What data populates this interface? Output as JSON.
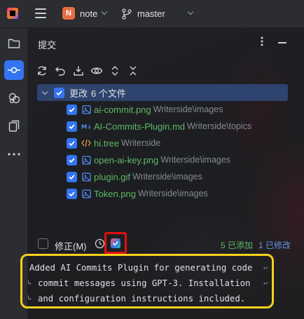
{
  "header": {
    "project_initial": "N",
    "project_name": "note",
    "branch_name": "master"
  },
  "panel": {
    "title": "提交",
    "more_icon": "more-vertical-icon",
    "minimize_icon": "minimize-icon"
  },
  "toolbar": {
    "icons": [
      "refresh-icon",
      "rollback-icon",
      "shelve-icon",
      "show-diff-icon",
      "expand-all-icon",
      "collapse-all-icon"
    ]
  },
  "changes": {
    "group_label": "更改",
    "group_count": "6 个文件",
    "files": [
      {
        "name": "ai-commit.png",
        "path": "Writerside\\images",
        "icon": "image-file-icon"
      },
      {
        "name": "AI-Commits-Plugin.md",
        "path": "Writerside\\topics",
        "icon": "markdown-file-icon"
      },
      {
        "name": "hi.tree",
        "path": "Writerside",
        "icon": "xml-file-icon"
      },
      {
        "name": "open-ai-key.png",
        "path": "Writerside\\images",
        "icon": "image-file-icon"
      },
      {
        "name": "plugin.gif",
        "path": "Writerside\\images",
        "icon": "image-file-icon"
      },
      {
        "name": "Token.png",
        "path": "Writerside\\images",
        "icon": "image-file-icon"
      }
    ]
  },
  "commit": {
    "amend_label": "修正(M)",
    "added_stat": "5 已添加",
    "modified_stat": "1 已修改",
    "message_lines": [
      "Added AI Commits Plugin for generating code",
      "commit messages using GPT-3. Installation",
      "and configuration instructions included."
    ]
  },
  "colors": {
    "accent": "#3574f0",
    "added_file": "#5fb865",
    "highlight_red": "#e11010",
    "highlight_yellow": "#f3d11c"
  }
}
